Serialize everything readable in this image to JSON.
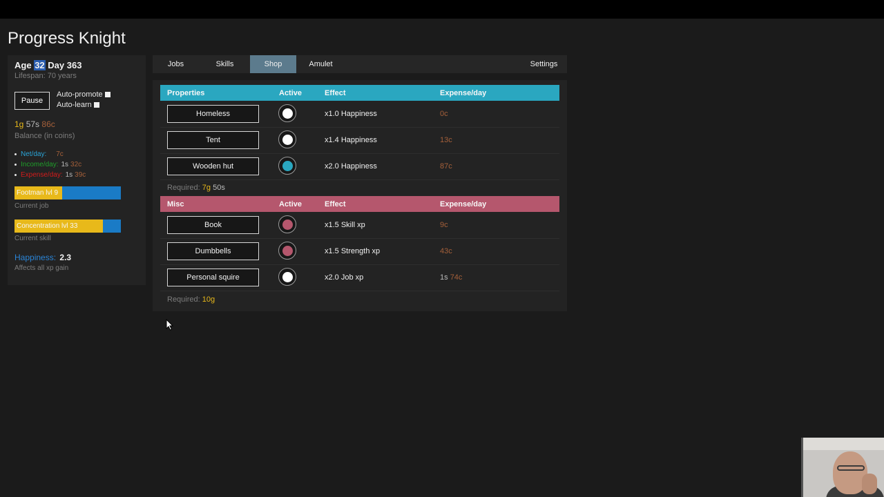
{
  "app": {
    "title": "Progress Knight"
  },
  "sidebar": {
    "age_label": "Age",
    "age_value": "32",
    "day_label": "Day",
    "day_value": "363",
    "lifespan": "Lifespan: 70 years",
    "pause_label": "Pause",
    "auto_promote_label": "Auto-promote",
    "auto_learn_label": "Auto-learn",
    "balance": {
      "gold": "1g",
      "silver": "57s",
      "copper": "86c"
    },
    "balance_label": "Balance (in coins)",
    "net_day": {
      "label": "Net/day:",
      "copper": "7c"
    },
    "income_day": {
      "label": "Income/day:",
      "silver": "1s",
      "copper": "32c"
    },
    "expense_day": {
      "label": "Expense/day:",
      "silver": "1s",
      "copper": "39c"
    },
    "current_job": {
      "text": "Footman lvl 9",
      "progress": 0.45,
      "label": "Current job"
    },
    "current_skill": {
      "text": "Concentration lvl 33",
      "progress": 0.83,
      "label": "Current skill"
    },
    "happiness": {
      "label": "Happiness:",
      "value": "2.3",
      "sub": "Affects all xp gain"
    }
  },
  "tabs": {
    "jobs": "Jobs",
    "skills": "Skills",
    "shop": "Shop",
    "amulet": "Amulet",
    "settings": "Settings",
    "active": "Shop"
  },
  "properties": {
    "header": {
      "name": "Properties",
      "active": "Active",
      "effect": "Effect",
      "expense": "Expense/day"
    },
    "header_color": "#2aa7c0",
    "items": [
      {
        "name": "Homeless",
        "effect": "x1.0 Happiness",
        "expense_silver": "",
        "expense_copper": "0c",
        "active": false
      },
      {
        "name": "Tent",
        "effect": "x1.4 Happiness",
        "expense_silver": "",
        "expense_copper": "13c",
        "active": false
      },
      {
        "name": "Wooden hut",
        "effect": "x2.0 Happiness",
        "expense_silver": "",
        "expense_copper": "87c",
        "active": true
      }
    ],
    "required_label": "Required:",
    "required_gold": "7g",
    "required_silver": "50s"
  },
  "misc": {
    "header": {
      "name": "Misc",
      "active": "Active",
      "effect": "Effect",
      "expense": "Expense/day"
    },
    "header_color": "#b5576d",
    "items": [
      {
        "name": "Book",
        "effect": "x1.5 Skill xp",
        "expense_silver": "",
        "expense_copper": "9c",
        "active": true
      },
      {
        "name": "Dumbbells",
        "effect": "x1.5 Strength xp",
        "expense_silver": "",
        "expense_copper": "43c",
        "active": true
      },
      {
        "name": "Personal squire",
        "effect": "x2.0 Job xp",
        "expense_silver": "1s",
        "expense_copper": "74c",
        "active": false
      }
    ],
    "required_label": "Required:",
    "required_gold": "10g"
  },
  "colors": {
    "properties_active": "#2aa7c0",
    "misc_active": "#b5576d",
    "inactive": "#ffffff",
    "gold": "#e8b91a",
    "copper": "#a5603a"
  }
}
